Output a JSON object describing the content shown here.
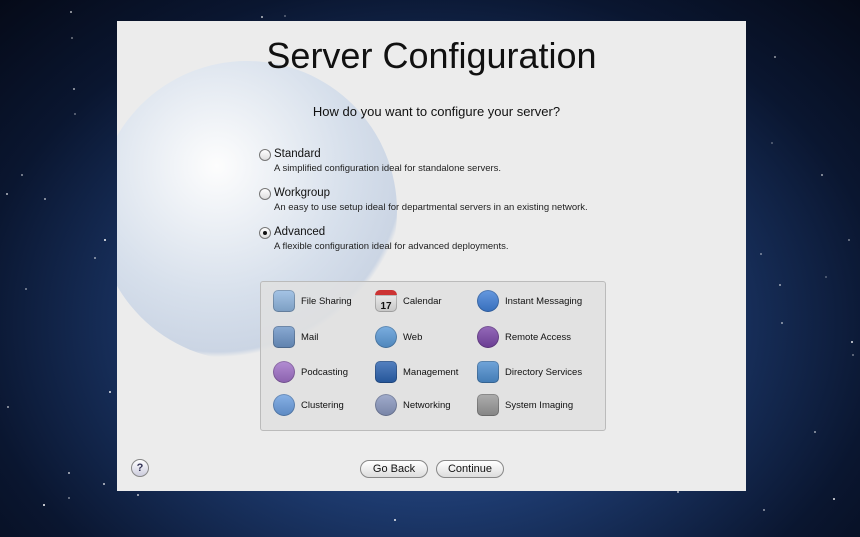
{
  "title": "Server Configuration",
  "question": "How do you want to configure your server?",
  "options": [
    {
      "label": "Standard",
      "desc": "A simplified configuration ideal for standalone servers.",
      "selected": false
    },
    {
      "label": "Workgroup",
      "desc": "An easy to use setup ideal for departmental servers in an existing network.",
      "selected": false
    },
    {
      "label": "Advanced",
      "desc": "A flexible configuration ideal for advanced deployments.",
      "selected": true
    }
  ],
  "services": [
    {
      "label": "File Sharing",
      "icon": "file-sharing-icon",
      "color": "#8fb6e0"
    },
    {
      "label": "Calendar",
      "icon": "calendar-icon",
      "color": "#e4e4e4",
      "text": "17"
    },
    {
      "label": "Instant Messaging",
      "icon": "chat-bubble-icon",
      "color": "#3f7fd8"
    },
    {
      "label": "Mail",
      "icon": "mail-icon",
      "color": "#6d95c8"
    },
    {
      "label": "Web",
      "icon": "compass-icon",
      "color": "#5a9ad8"
    },
    {
      "label": "Remote Access",
      "icon": "remote-access-icon",
      "color": "#7a45a8"
    },
    {
      "label": "Podcasting",
      "icon": "podcast-icon",
      "color": "#a070c8"
    },
    {
      "label": "Management",
      "icon": "management-icon",
      "color": "#2a62b0"
    },
    {
      "label": "Directory Services",
      "icon": "directory-icon",
      "color": "#4d8ed0"
    },
    {
      "label": "Clustering",
      "icon": "clustering-icon",
      "color": "#6a9ee0"
    },
    {
      "label": "Networking",
      "icon": "networking-icon",
      "color": "#8a98c0"
    },
    {
      "label": "System Imaging",
      "icon": "system-imaging-icon",
      "color": "#999999"
    }
  ],
  "buttons": {
    "back": "Go Back",
    "continue": "Continue",
    "help": "?"
  }
}
